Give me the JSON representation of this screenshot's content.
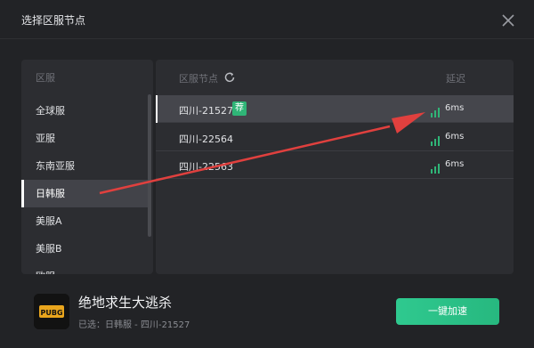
{
  "header": {
    "title": "选择区服节点"
  },
  "regions": {
    "heading": "区服",
    "items": [
      {
        "label": "全球服"
      },
      {
        "label": "亚服"
      },
      {
        "label": "东南亚服"
      },
      {
        "label": "日韩服"
      },
      {
        "label": "美服A"
      },
      {
        "label": "美服B"
      },
      {
        "label": "欧服"
      }
    ],
    "selected": "日韩服"
  },
  "nodes": {
    "column_node": "区服节点",
    "column_latency": "延迟",
    "rows": [
      {
        "name": "四川-21527",
        "tag": "荐",
        "latency": "6ms"
      },
      {
        "name": "四川-22564",
        "latency": "6ms"
      },
      {
        "name": "四川-22563",
        "latency": "6ms"
      }
    ]
  },
  "game": {
    "icon_text": "PUBG",
    "title": "绝地求生大逃杀",
    "selection": "已选：日韩服 - 四川-21527"
  },
  "accelerate_button": "一键加速",
  "colors": {
    "accent": "#2fc98f",
    "signal": "#2fb577",
    "annotation_arrow": "#e0403e"
  },
  "icons": {
    "close": "close-icon",
    "refresh": "refresh-icon",
    "signal": "signal-bars-icon",
    "annotation": "red-arrow-annotation"
  }
}
